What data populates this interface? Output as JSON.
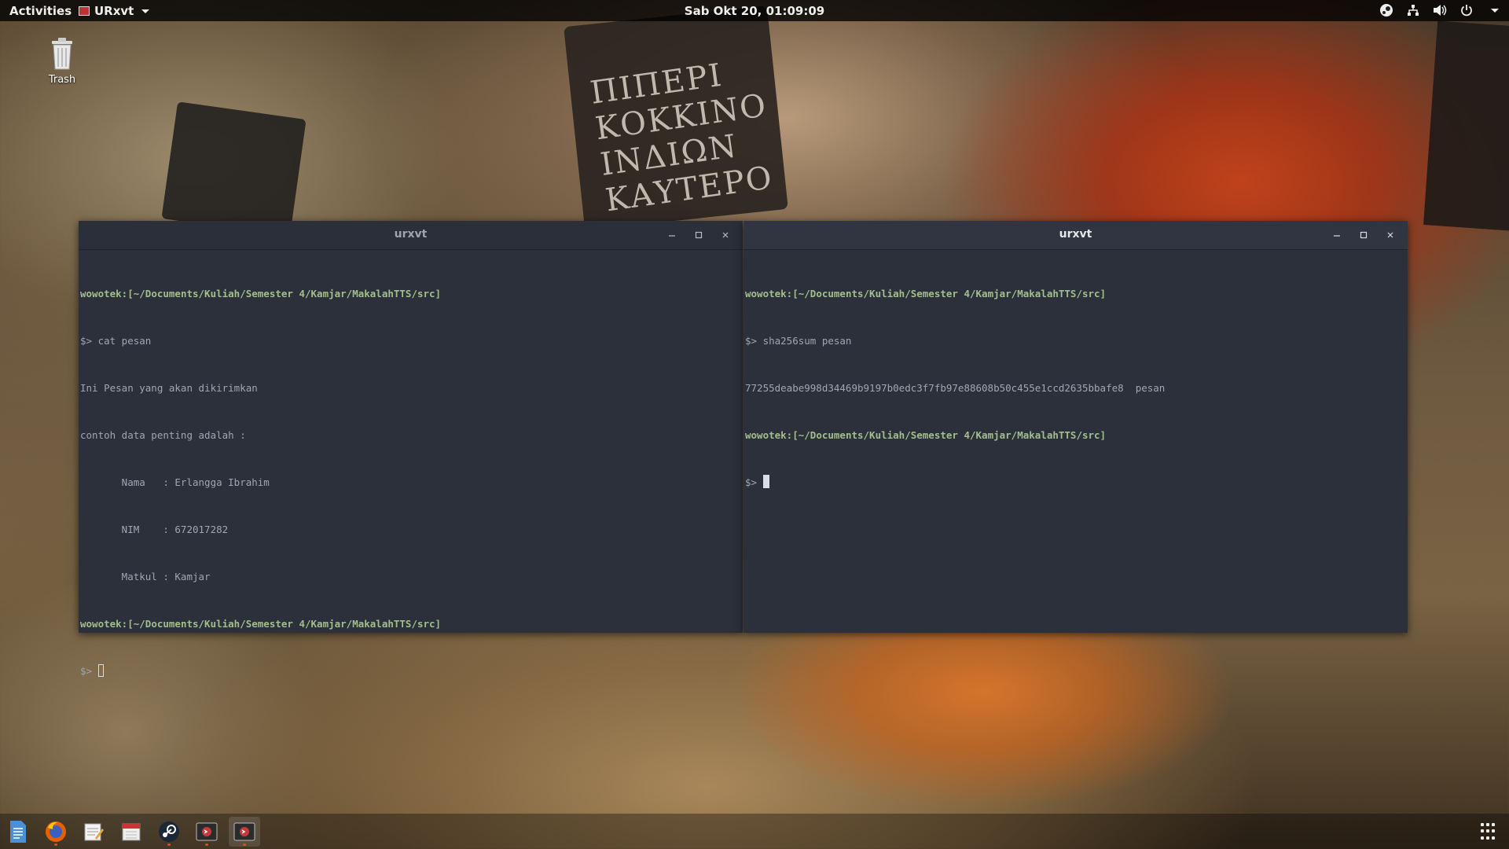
{
  "topbar": {
    "activities": "Activities",
    "app_menu": "URxvt",
    "clock": "Sab Okt 20, 01:09:09",
    "tray_icons": [
      "steam-icon",
      "network-icon",
      "volume-icon",
      "power-icon",
      "chevron-down-icon"
    ]
  },
  "desktop": {
    "trash_label": "Trash"
  },
  "wallpaper": {
    "sign_text": [
      "ΠΙΠΕΡΙ",
      "ΚΟΚΚΙΝΟ",
      "ΙΝΔΙΩΝ",
      "ΚΑΥΤΕΡΟ"
    ]
  },
  "windows": {
    "left": {
      "title": "urxvt",
      "prompt_user": "wowotek:",
      "prompt_path": "[~/Documents/Kuliah/Semester 4/Kamjar/MakalahTTS/src]",
      "cmd1": "$> cat pesan",
      "out1": "Ini Pesan yang akan dikirimkan",
      "out2": "contoh data penting adalah :",
      "out3": "       Nama   : Erlangga Ibrahim",
      "out4": "       NIM    : 672017282",
      "out5": "       Matkul : Kamjar",
      "prompt_symbol": "$>"
    },
    "right": {
      "title": "urxvt",
      "prompt_user": "wowotek:",
      "prompt_path": "[~/Documents/Kuliah/Semester 4/Kamjar/MakalahTTS/src]",
      "cmd1": "$> sha256sum pesan",
      "out1": "77255deabe998d34469b9197b0edc3f7fb97e88608b50c455e1ccd2635bbafe8  pesan",
      "prompt_symbol": "$>"
    }
  },
  "dock": {
    "items": [
      "document-viewer-icon",
      "firefox-icon",
      "text-editor-icon",
      "calendar-icon",
      "steam-icon",
      "terminal-icon",
      "terminal-icon"
    ]
  },
  "colors": {
    "terminal_bg": "#2b303b",
    "prompt_green": "#a3be8c",
    "accent_orange": "#e64b1e"
  }
}
